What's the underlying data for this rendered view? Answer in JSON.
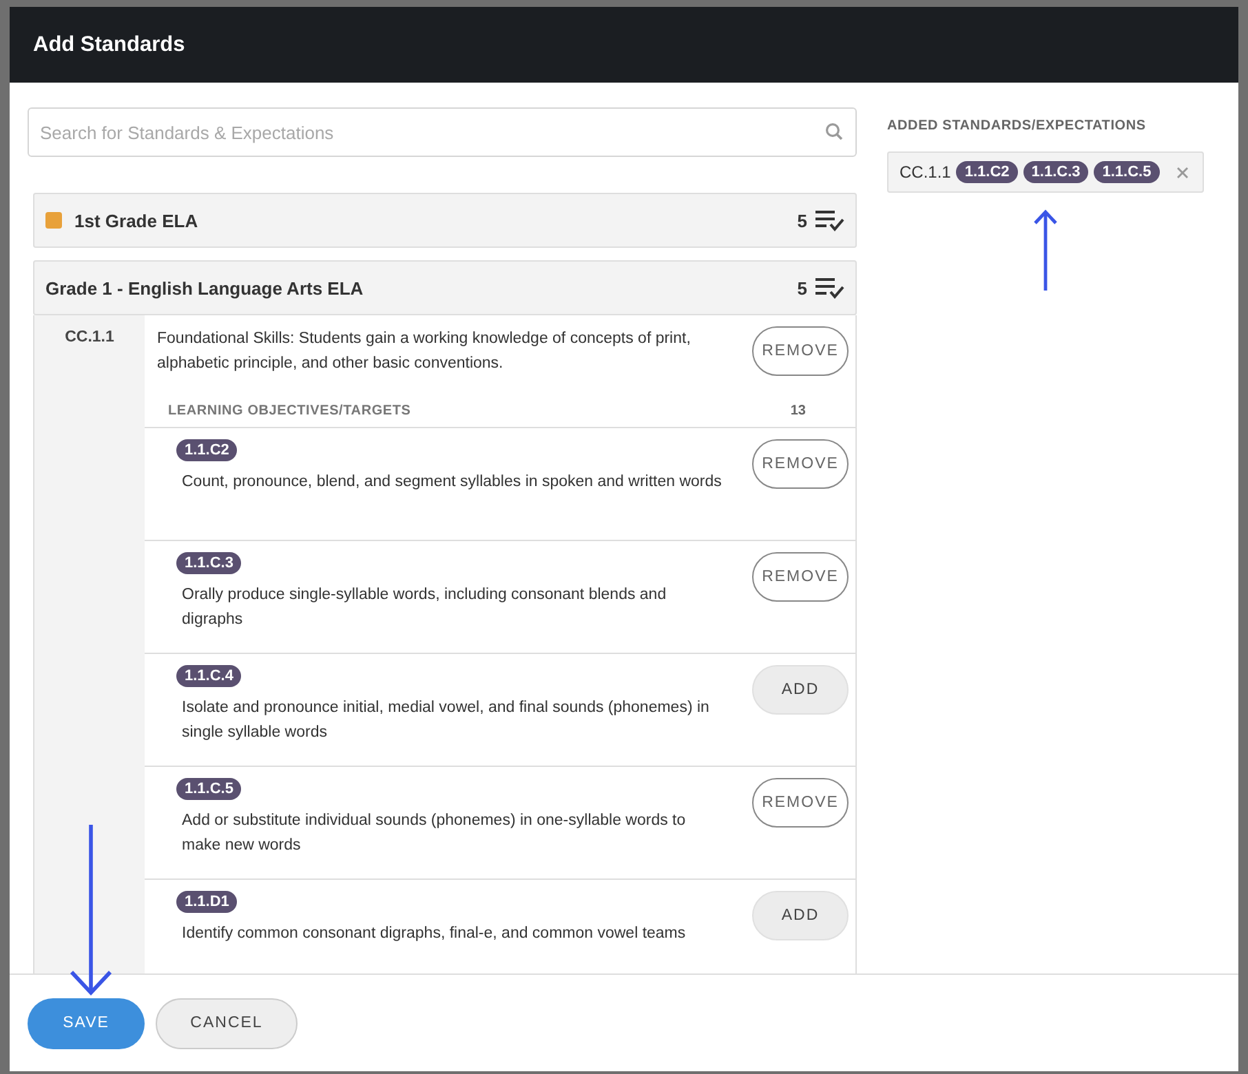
{
  "window": {
    "title": "Add Standards"
  },
  "search": {
    "placeholder": "Search for Standards & Expectations"
  },
  "groups": [
    {
      "title": "1st Grade ELA",
      "color": "#e8a13a",
      "count": "5"
    },
    {
      "title": "Grade 1 - English Language Arts ELA",
      "count": "5"
    }
  ],
  "standard": {
    "code": "CC.1.1",
    "text": "Foundational Skills: Students gain a working knowledge of concepts of print, alphabetic principle, and other basic conventions.",
    "added": true,
    "action": "REMOVE"
  },
  "objectives_header": {
    "label": "LEARNING OBJECTIVES/TARGETS",
    "count": "13"
  },
  "objectives": [
    {
      "code": "1.1.C2",
      "text": "Count, pronounce, blend, and segment syllables in spoken and written words",
      "added": true,
      "action": "REMOVE"
    },
    {
      "code": "1.1.C.3",
      "text": "Orally produce single-syllable words, including consonant blends and digraphs",
      "added": true,
      "action": "REMOVE"
    },
    {
      "code": "1.1.C.4",
      "text": "Isolate and pronounce initial, medial vowel, and final sounds (phonemes) in single syllable words",
      "added": false,
      "action": "ADD"
    },
    {
      "code": "1.1.C.5",
      "text": "Add or substitute individual sounds (phonemes) in one-syllable words to make new words",
      "added": true,
      "action": "REMOVE"
    },
    {
      "code": "1.1.D1",
      "text": "Identify common consonant digraphs, final-e, and common vowel teams",
      "added": false,
      "action": "ADD"
    }
  ],
  "added_panel": {
    "title": "ADDED STANDARDS/EXPECTATIONS",
    "standard": "CC.1.1",
    "chips": [
      "1.1.C2",
      "1.1.C.3",
      "1.1.C.5"
    ]
  },
  "buttons": [
    {
      "label": "SAVE",
      "kind": "primary"
    },
    {
      "label": "CANCEL",
      "kind": "secondary"
    }
  ]
}
